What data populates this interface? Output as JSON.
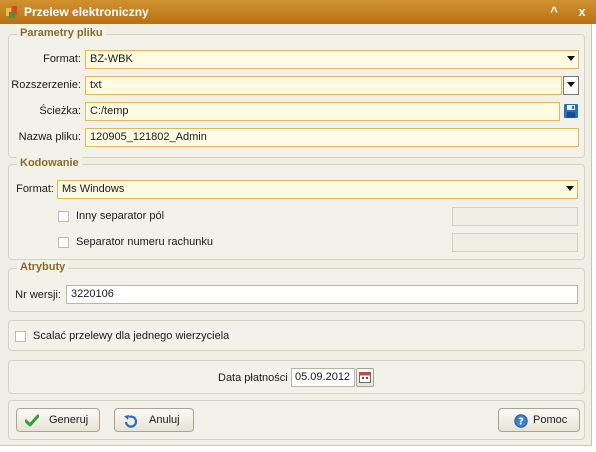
{
  "window": {
    "title": "Przelew elektroniczny",
    "minimize_glyph": "^",
    "close_glyph": "x"
  },
  "file_params": {
    "legend": "Parametry pliku",
    "format_label": "Format:",
    "format_value": "BZ-WBK",
    "ext_label": "Rozszerzenie:",
    "ext_value": "txt",
    "path_label": "Ścieżka:",
    "path_value": "C:/temp",
    "name_label": "Nazwa pliku:",
    "name_value": "120905_121802_Admin"
  },
  "encoding": {
    "legend": "Kodowanie",
    "format_label": "Format:",
    "format_value": "Ms Windows",
    "other_separator_label": "Inny separator pól",
    "other_separator_checked": false,
    "account_separator_label": "Separator numeru rachunku",
    "account_separator_checked": false
  },
  "attributes": {
    "legend": "Atrybuty",
    "version_label": "Nr wersji:",
    "version_value": "3220106"
  },
  "merge": {
    "label": "Scalać przelewy dla jednego wierzyciela",
    "checked": false
  },
  "payment": {
    "label": "Data płatności",
    "date_value": "05.09.2012"
  },
  "buttons": {
    "generate": "Generuj",
    "cancel": "Anuluj",
    "help": "Pomoc"
  },
  "colors": {
    "title_bar": "#c07e1e",
    "legend_text": "#8a6a2a",
    "field_bg": "#fffbe3",
    "field_border": "#e0b65e"
  }
}
